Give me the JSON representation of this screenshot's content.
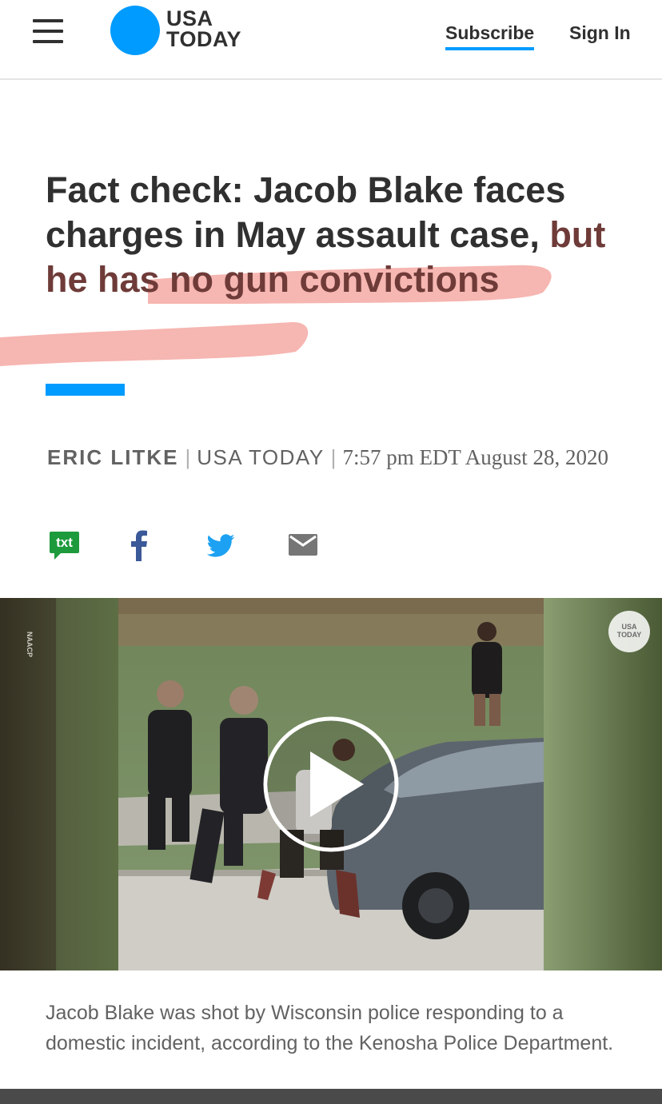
{
  "header": {
    "logo_text": "USA\nTODAY",
    "subscribe_label": "Subscribe",
    "signin_label": "Sign In"
  },
  "article": {
    "headline_part1": "Fact check: Jacob Blake faces charges in May assault case, ",
    "headline_highlighted": "but he has no gun convictions",
    "author": "ERIC LITKE",
    "source": "USA TODAY",
    "date": "7:57 pm EDT August 28, 2020",
    "caption": "Jacob Blake was shot by Wisconsin police responding to a domestic incident, according to the Kenosha Police Department."
  },
  "share": {
    "txt_label": "txt",
    "icons": [
      "sms-icon",
      "facebook-icon",
      "twitter-icon",
      "email-icon"
    ]
  },
  "video": {
    "watermark": "USA\nTODAY",
    "side_text": "NAACP"
  },
  "colors": {
    "brand_blue": "#009bff",
    "text_dark": "#303030",
    "text_muted": "#626262",
    "sms_green": "#1d9a3c",
    "facebook_blue": "#3b5998",
    "twitter_blue": "#1da1f2",
    "email_gray": "#767676",
    "highlight_pink": "#f4a9a3"
  }
}
